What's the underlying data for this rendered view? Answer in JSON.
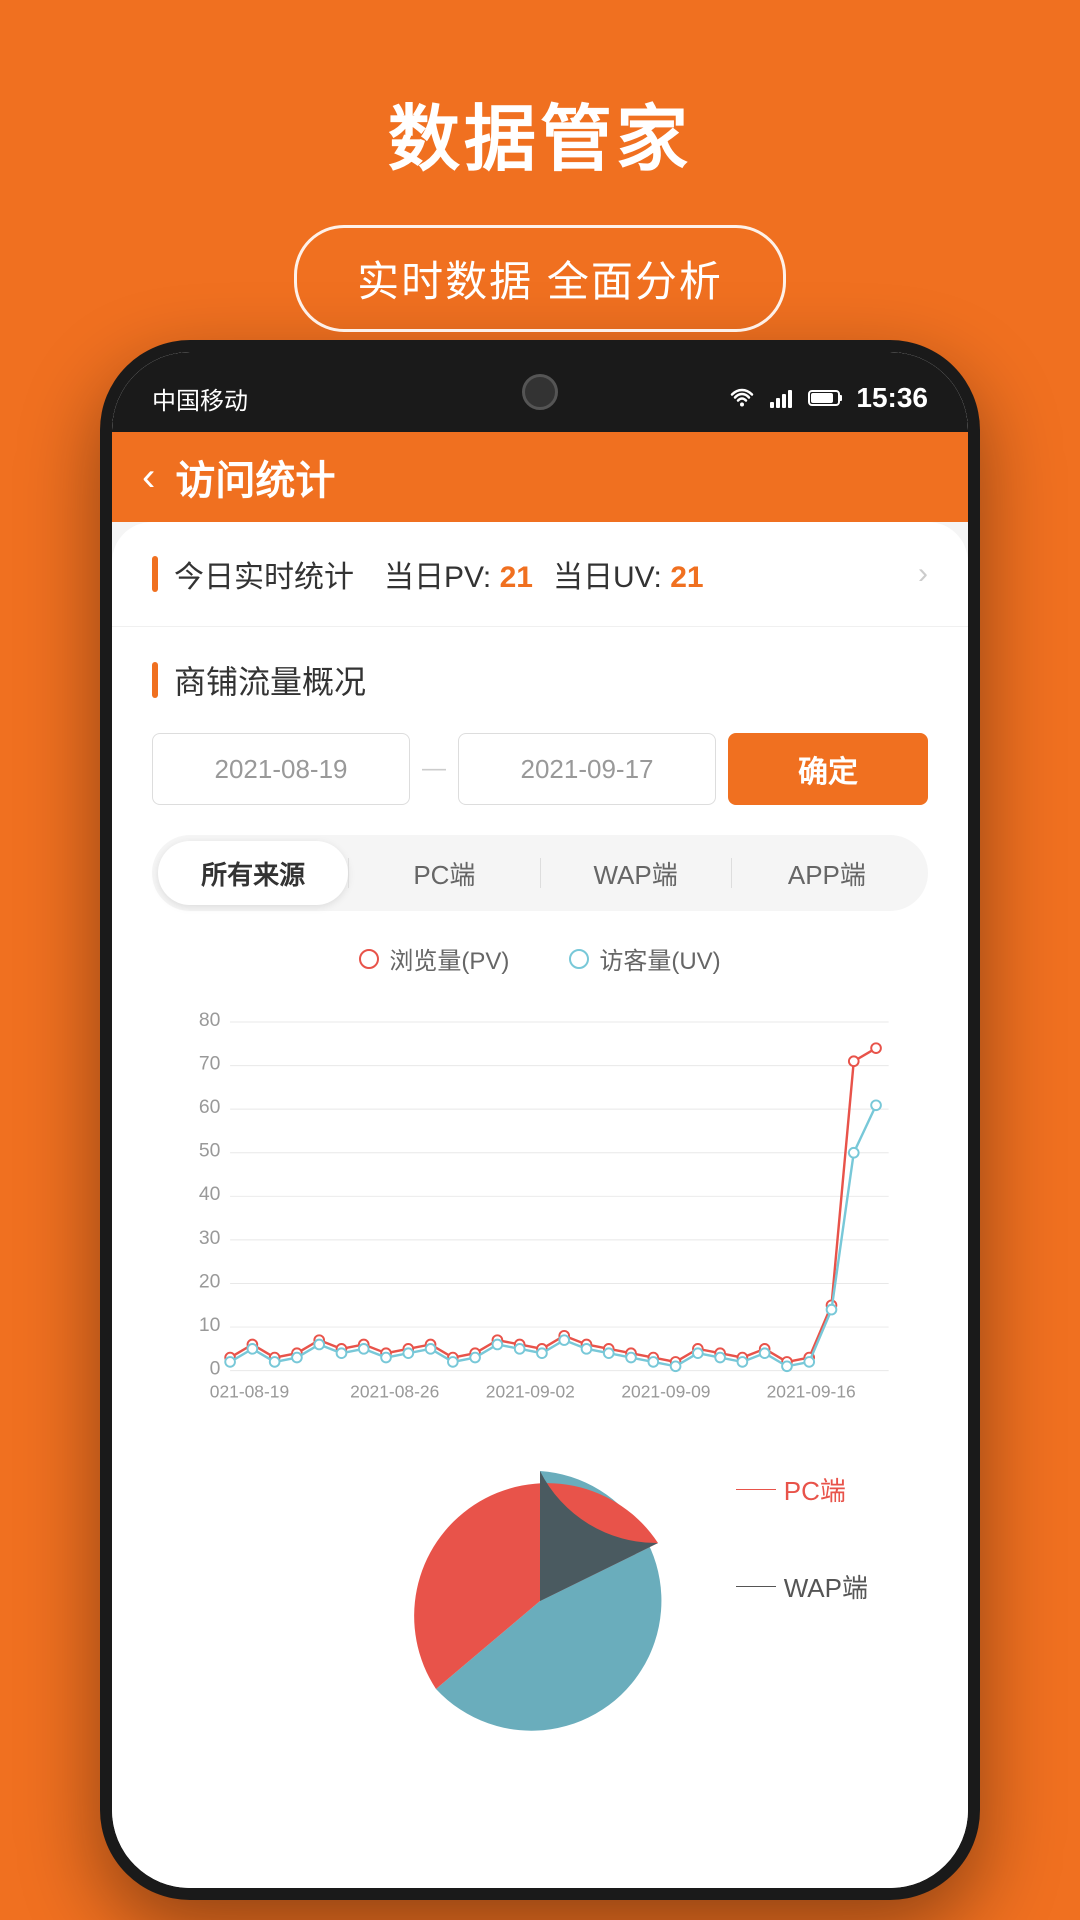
{
  "app": {
    "title": "数据管家",
    "subtitle": "实时数据 全面分析"
  },
  "status_bar": {
    "carrier": "中国移动",
    "time": "15:36",
    "wifi_icon": "wifi",
    "signal_icon": "signal",
    "battery_icon": "battery"
  },
  "header": {
    "back_icon": "‹",
    "title": "访问统计"
  },
  "today_stats": {
    "label": "今日实时统计",
    "pv_label": "当日PV:",
    "pv_value": "21",
    "uv_label": "当日UV:",
    "uv_value": "21"
  },
  "traffic": {
    "section_title": "商铺流量概况",
    "date_start": "2021-08-19",
    "date_end": "2021-09-17",
    "confirm_label": "确定"
  },
  "tabs": [
    {
      "label": "所有来源",
      "active": true
    },
    {
      "label": "PC端",
      "active": false
    },
    {
      "label": "WAP端",
      "active": false
    },
    {
      "label": "APP端",
      "active": false
    }
  ],
  "chart": {
    "legend_pv": "浏览量(PV)",
    "legend_uv": "访客量(UV)",
    "y_axis": [
      80,
      70,
      60,
      50,
      40,
      30,
      20,
      10,
      0
    ],
    "x_axis": [
      "021-08-19",
      "2021-08-26",
      "2021-09-02",
      "2021-09-09",
      "2021-09-16"
    ],
    "pv_data": [
      3,
      6,
      3,
      4,
      7,
      5,
      6,
      4,
      5,
      6,
      3,
      4,
      7,
      6,
      5,
      8,
      6,
      5,
      4,
      3,
      2,
      5,
      4,
      3,
      5,
      2,
      3,
      15,
      71,
      75
    ],
    "uv_data": [
      2,
      5,
      2,
      3,
      6,
      4,
      5,
      3,
      4,
      5,
      2,
      3,
      6,
      5,
      4,
      7,
      5,
      4,
      3,
      2,
      1,
      4,
      3,
      2,
      4,
      1,
      2,
      14,
      50,
      61
    ]
  },
  "pie": {
    "pc_label": "PC端",
    "wap_label": "WAP端",
    "pc_color": "#e8534a",
    "wap_color": "#4a5a60",
    "teal_color": "#6aadbc"
  }
}
